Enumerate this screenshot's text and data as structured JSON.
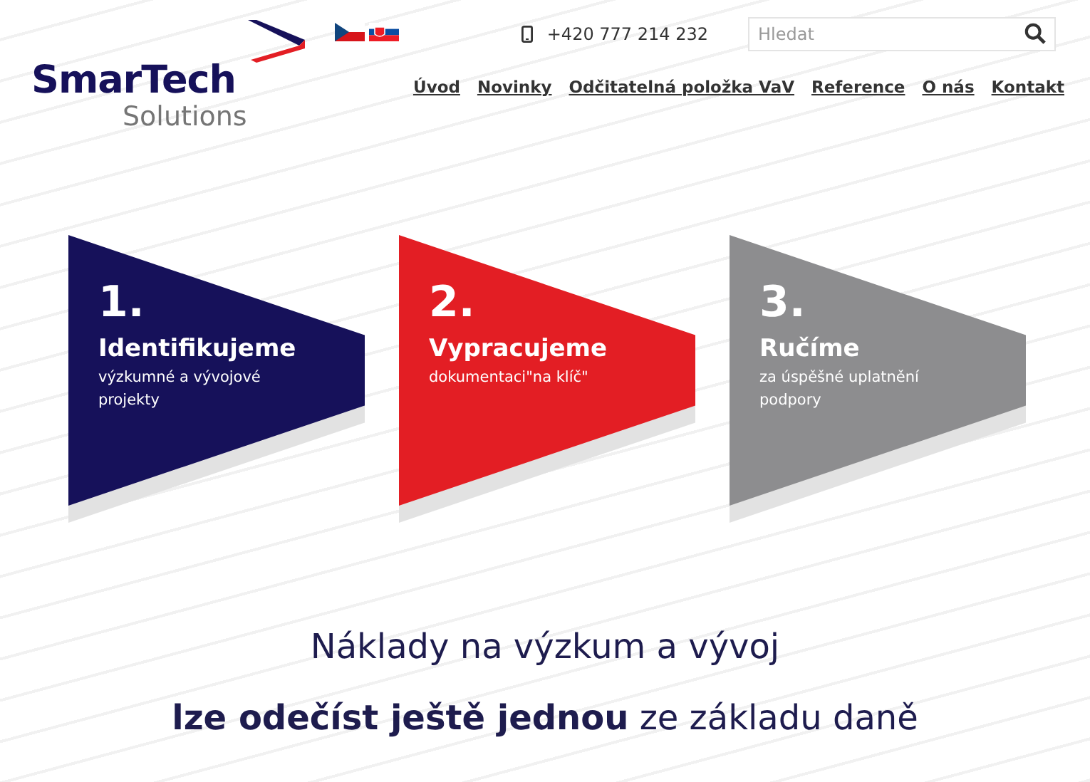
{
  "logo": {
    "name": "SmarTech",
    "tagline": "Solutions"
  },
  "phone": "+420 777 214 232",
  "search": {
    "placeholder": "Hledat"
  },
  "nav": [
    "Úvod",
    "Novinky",
    "Odčitatelná položka VaV",
    "Reference",
    "O nás",
    "Kontakt"
  ],
  "steps": [
    {
      "number": "1.",
      "title": "Identifikujeme",
      "text": "výzkumné a vývojové projekty",
      "color": "#16115a"
    },
    {
      "number": "2.",
      "title": "Vypracujeme",
      "text": "dokumentaci\"na klíč\"",
      "color": "#e31e24"
    },
    {
      "number": "3.",
      "title": "Ručíme",
      "text": "za úspěšné uplatnění podpory",
      "color": "#8d8d8f"
    }
  ],
  "headline": "Náklady na výzkum a vývoj",
  "subheadline": "**lze odečíst ještě jednou** ze základu daně"
}
